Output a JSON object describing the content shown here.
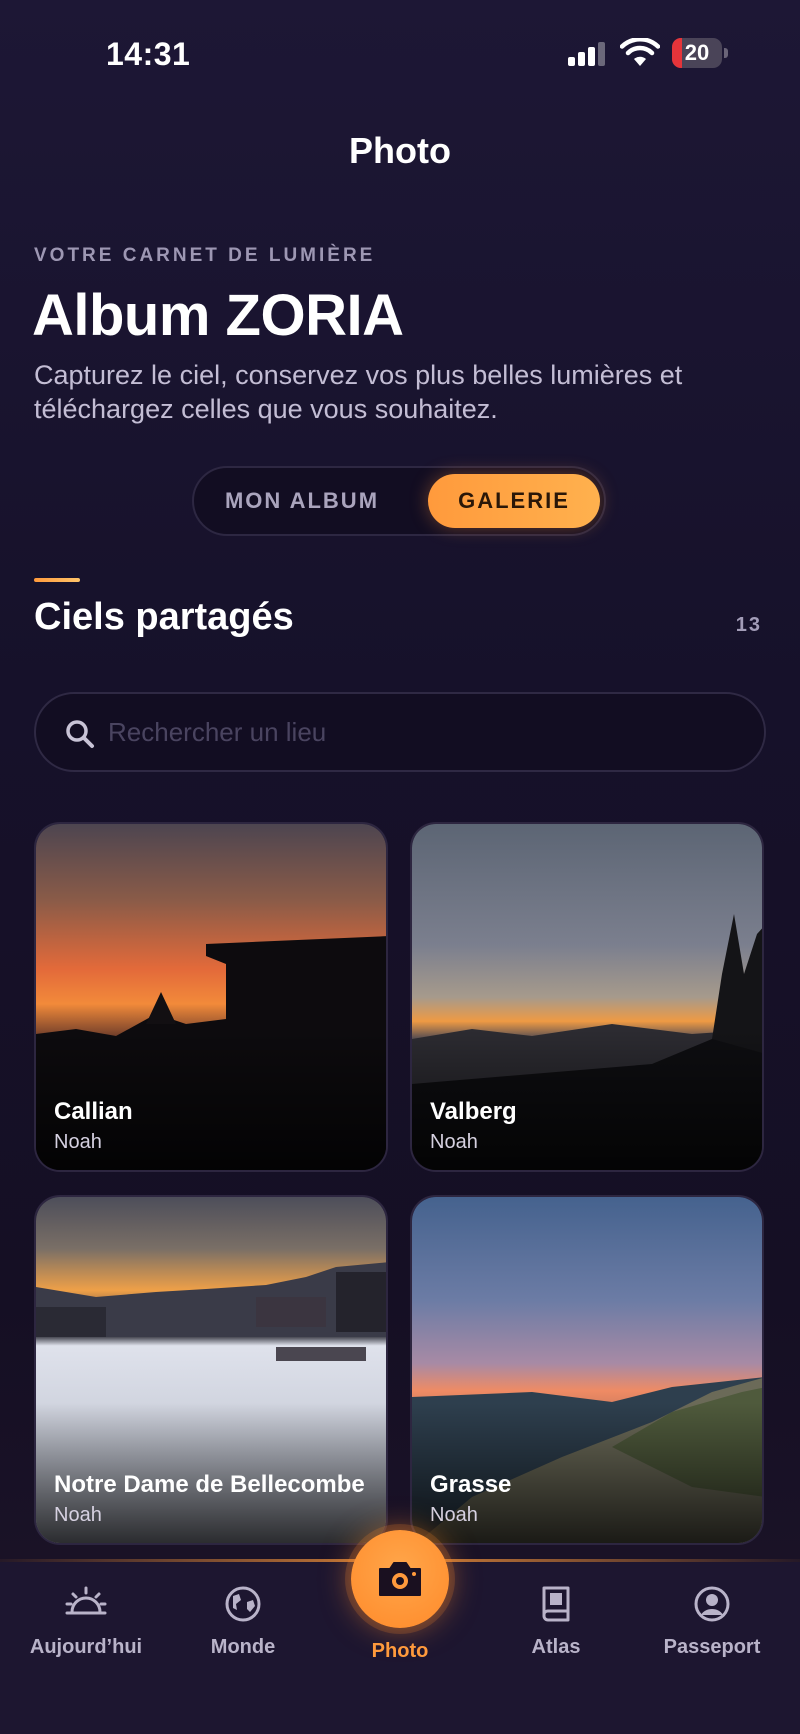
{
  "status_bar": {
    "time": "14:31",
    "battery": "20",
    "battery_color": "#e5343a"
  },
  "header": {
    "title": "Photo"
  },
  "intro": {
    "eyebrow": "VOTRE CARNET DE LUMIÈRE",
    "title": "Album ZORIA",
    "subtitle": "Capturez le ciel, conservez vos plus belles lumières et téléchargez celles que vous souhaitez."
  },
  "segmented": {
    "options": [
      "MON ALBUM",
      "GALERIE"
    ],
    "selected": "GALERIE",
    "accent": "#ff9a3c"
  },
  "section": {
    "title": "Ciels partagés",
    "count": "13"
  },
  "search": {
    "placeholder": "Rechercher un lieu",
    "value": "",
    "icon": "search-icon"
  },
  "cards": [
    {
      "title": "Callian",
      "author": "Noah"
    },
    {
      "title": "Valberg",
      "author": "Noah"
    },
    {
      "title": "Notre Dame de Bellecombe",
      "author": "Noah"
    },
    {
      "title": "Grasse",
      "author": "Noah"
    }
  ],
  "tabs": [
    {
      "label": "Aujourd’hui",
      "icon": "sunrise-icon"
    },
    {
      "label": "Monde",
      "icon": "globe-icon"
    },
    {
      "label": "Photo",
      "icon": "camera-icon",
      "active": true
    },
    {
      "label": "Atlas",
      "icon": "book-icon"
    },
    {
      "label": "Passeport",
      "icon": "user-circle-icon"
    }
  ]
}
